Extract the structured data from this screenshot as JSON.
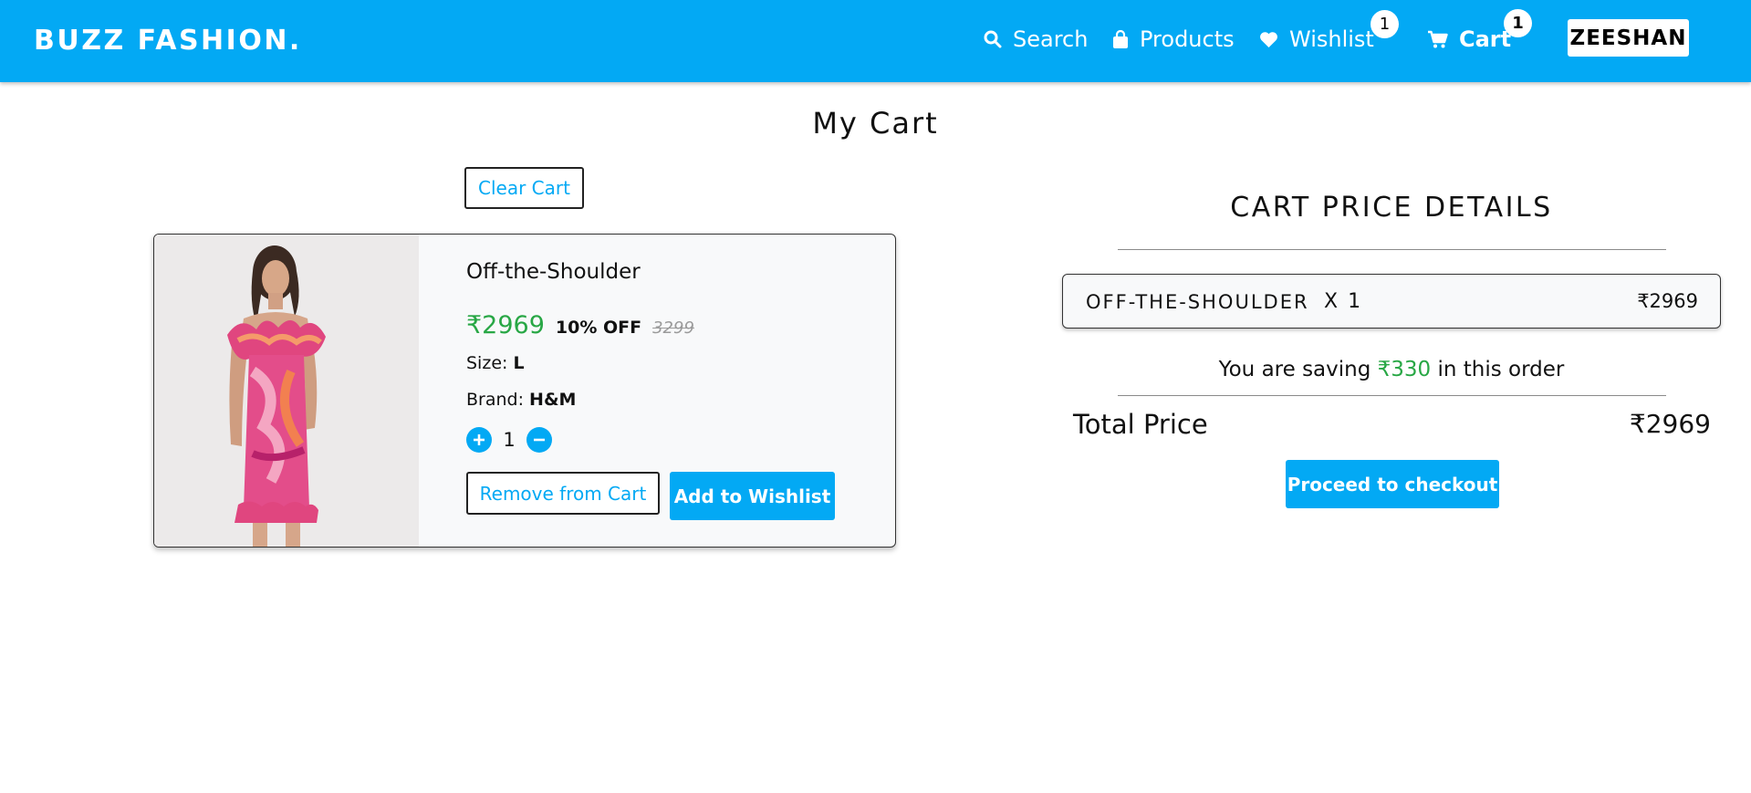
{
  "nav": {
    "logo": "BUZZ FASHION.",
    "search_label": "Search",
    "products_label": "Products",
    "wishlist_label": "Wishlist",
    "wishlist_count": "1",
    "cart_label": "Cart",
    "cart_count": "1",
    "user_name": "ZEESHAN"
  },
  "page_title": "My Cart",
  "clear_cart_label": "Clear Cart",
  "cart_item": {
    "name": "Off-the-Shoulder",
    "price": "₹2969",
    "discount": "10% OFF",
    "mrp": "3299",
    "size_label": "Size:",
    "size_value": "L",
    "brand_label": "Brand:",
    "brand_value": "H&M",
    "quantity": "1",
    "remove_label": "Remove from Cart",
    "wishlist_label": "Add to Wishlist"
  },
  "price_details": {
    "title": "CART PRICE DETAILS",
    "line_name": "OFF-THE-SHOULDER",
    "line_qty": "X 1",
    "line_price": "₹2969",
    "saving_prefix": "You are saving",
    "saving_amount": "₹330",
    "saving_suffix": "in this order",
    "total_label": "Total Price",
    "total_value": "₹2969",
    "checkout_label": "Proceed to checkout"
  },
  "colors": {
    "accent": "#03a9f4",
    "price_green": "#28a745",
    "card_bg": "#f8f9fa"
  },
  "icons": [
    "search-icon",
    "shopping-bag-icon",
    "heart-icon",
    "cart-icon",
    "plus-icon",
    "minus-icon"
  ]
}
